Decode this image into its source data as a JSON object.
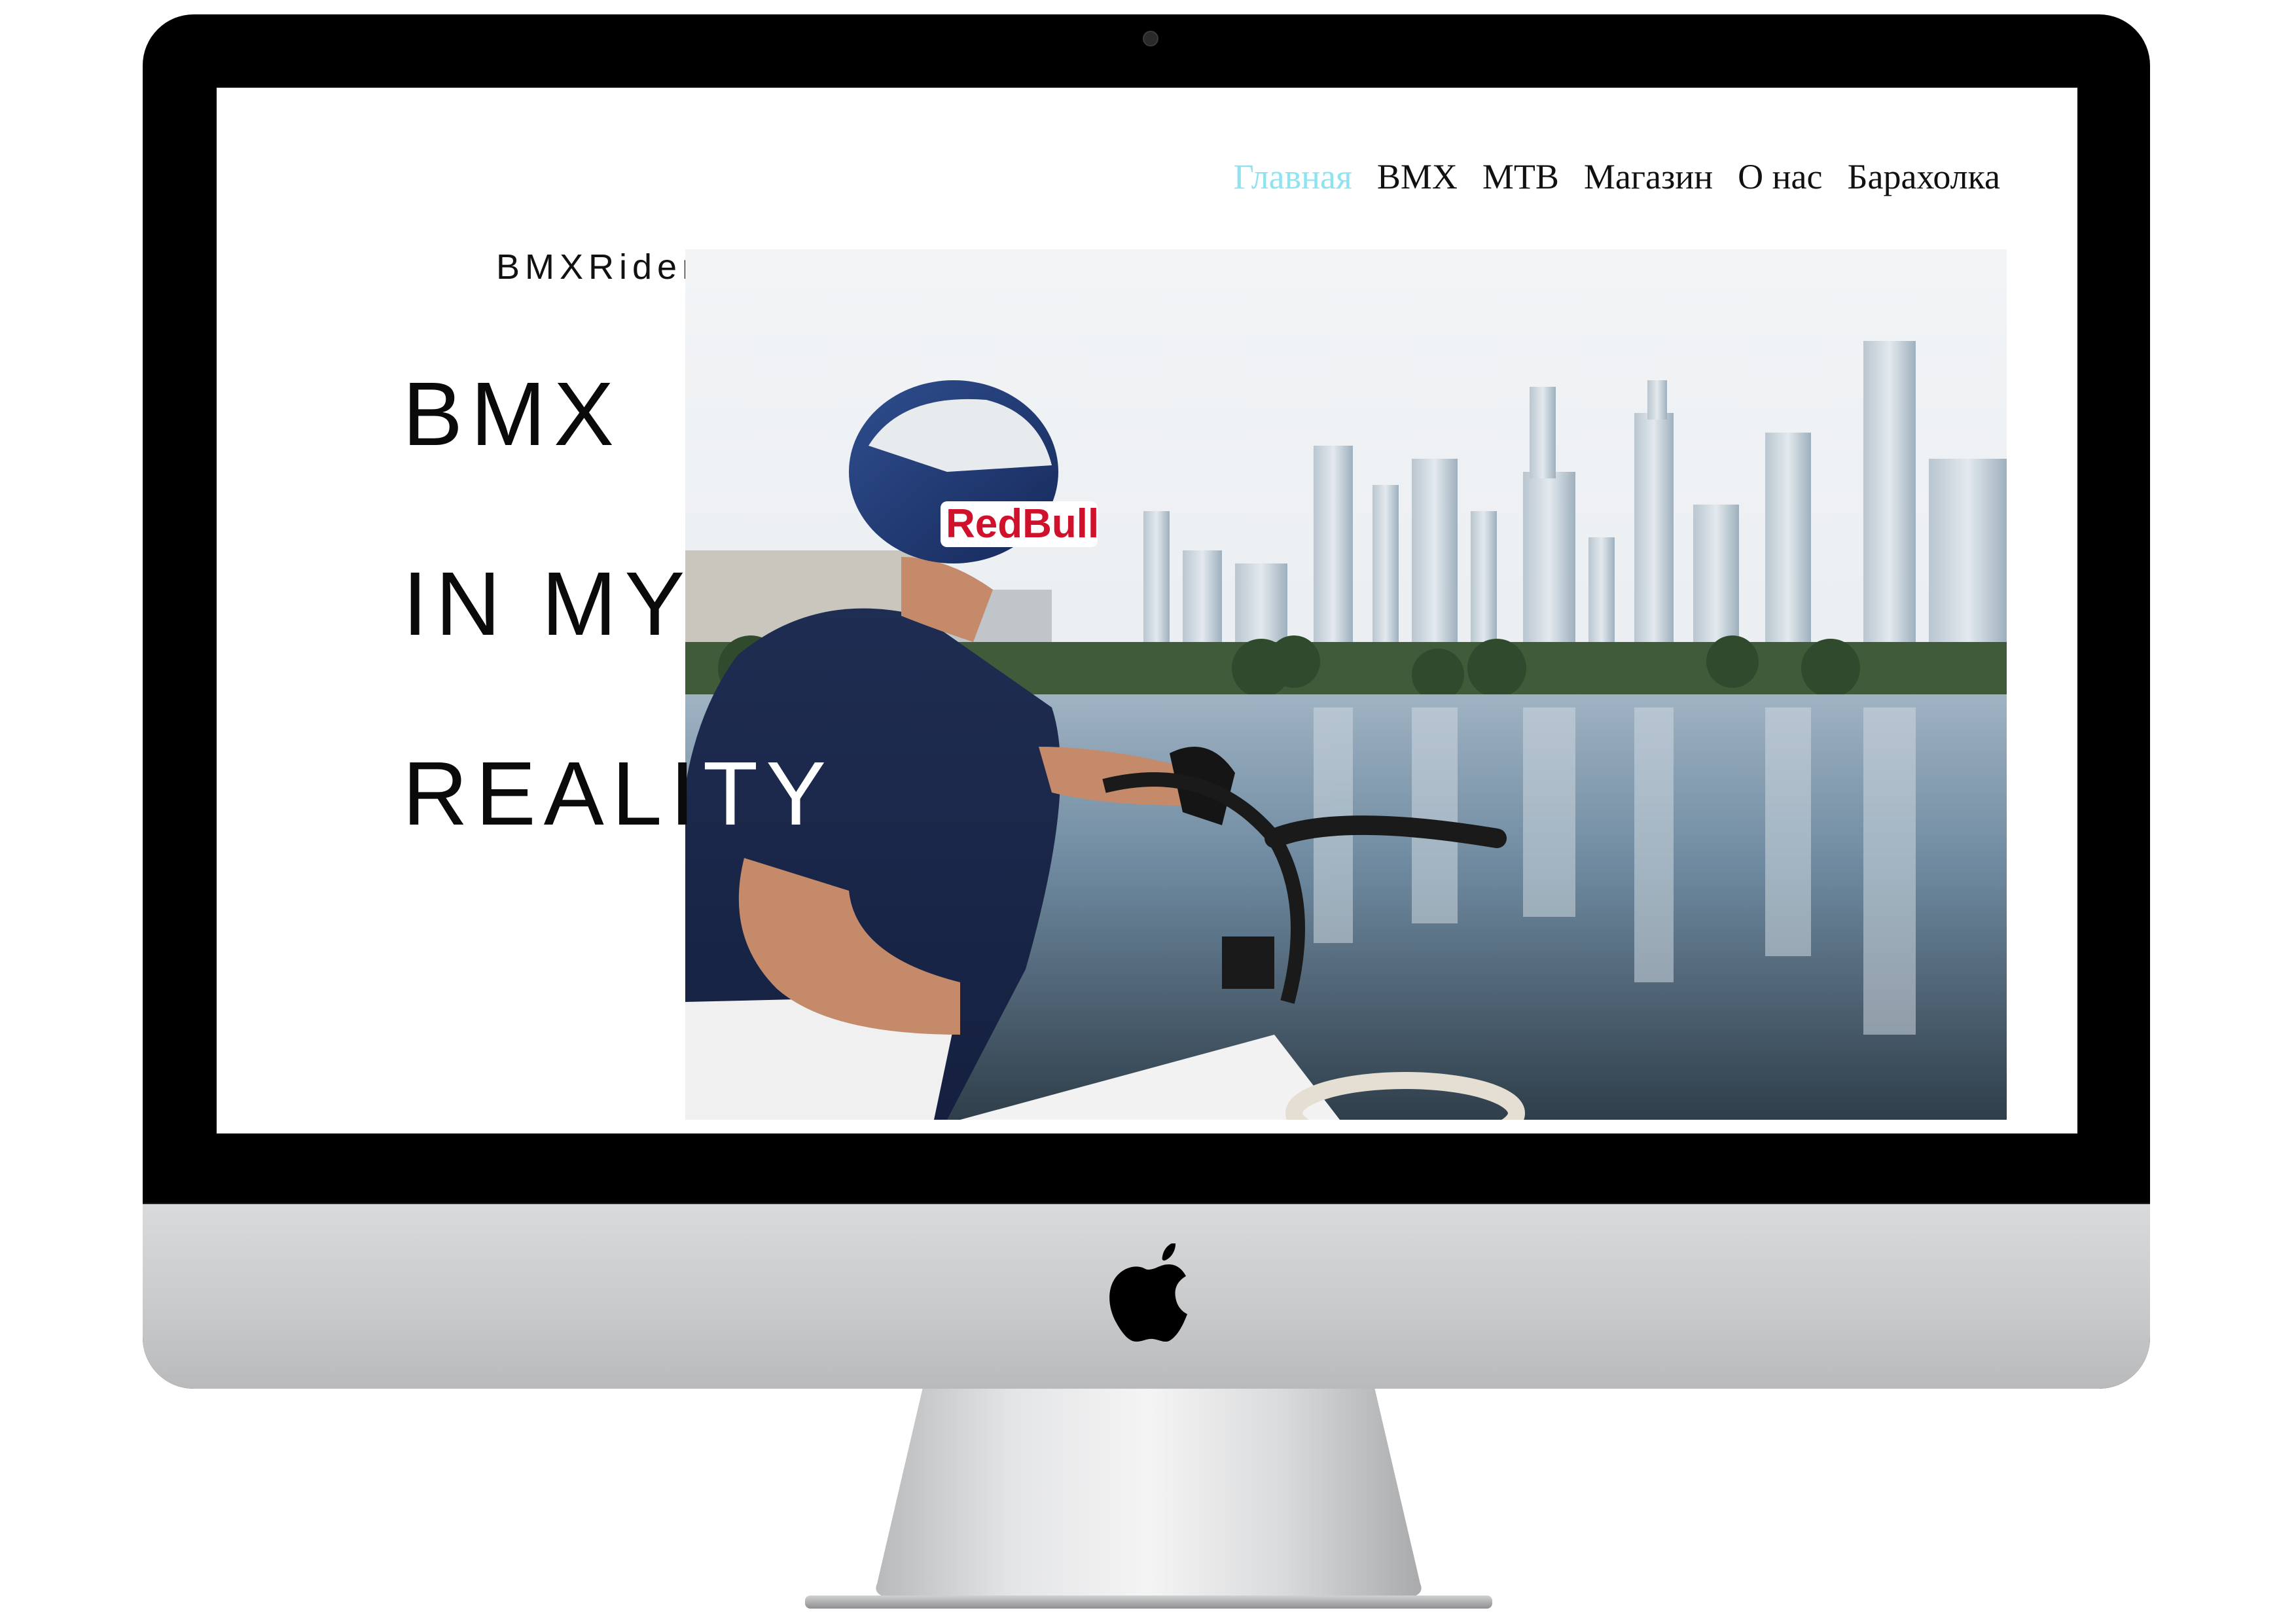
{
  "nav": {
    "items": [
      {
        "label": "Главная",
        "active": true
      },
      {
        "label": "BMX",
        "active": false
      },
      {
        "label": "MTB",
        "active": false
      },
      {
        "label": "Магазин",
        "active": false
      },
      {
        "label": "О нас",
        "active": false
      },
      {
        "label": "Барахолка",
        "active": false
      }
    ],
    "active_color": "#8fe3ef"
  },
  "brand": "BMXRider//",
  "hero": {
    "line1": "BMX",
    "line2_a": "IN MY",
    "line2_b": "",
    "line3_a": "REALI",
    "line3_b": "TY",
    "image_icon": "bmx-rider-city-photo"
  },
  "helmet_text": "RedBull",
  "device": {
    "logo_icon": "apple-logo-icon",
    "bezel_color": "#000000",
    "chin_color": "#c9cacc"
  }
}
